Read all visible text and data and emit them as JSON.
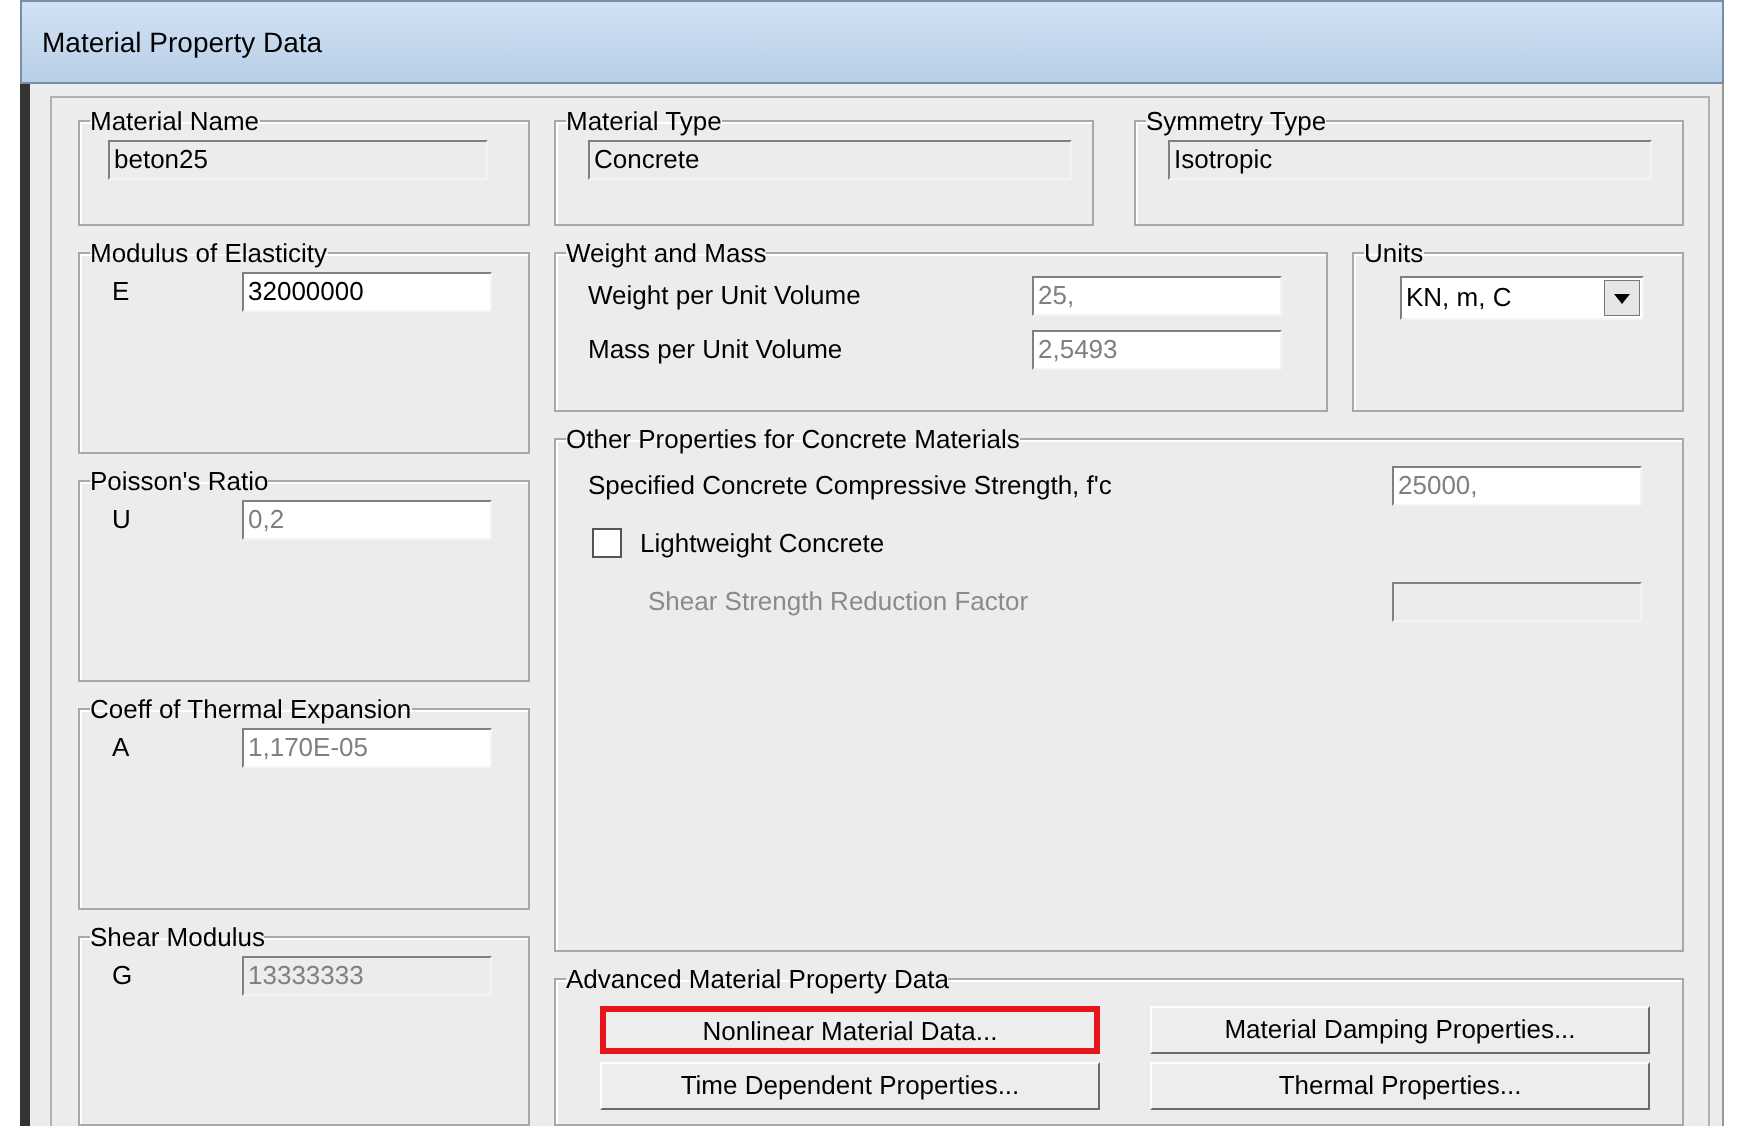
{
  "window": {
    "title": "Material Property Data"
  },
  "material_name": {
    "title": "Material Name",
    "field": {
      "value": "beton25",
      "readonly": true,
      "disabled": false
    }
  },
  "material_type": {
    "title": "Material Type",
    "field": {
      "value": "Concrete",
      "readonly": true,
      "disabled": false
    }
  },
  "symmetry_type": {
    "title": "Symmetry Type",
    "field": {
      "value": "Isotropic",
      "readonly": true,
      "disabled": false
    }
  },
  "left_groups": [
    {
      "title": "Modulus of Elasticity",
      "symbol": "E",
      "field": {
        "value": "32000000",
        "readonly": false,
        "disabled": false
      }
    },
    {
      "title": "Poisson's Ratio",
      "symbol": "U",
      "field": {
        "value": "0,2",
        "readonly": false,
        "disabled": true
      }
    },
    {
      "title": "Coeff of Thermal Expansion",
      "symbol": "A",
      "field": {
        "value": "1,170E-05",
        "readonly": false,
        "disabled": true
      }
    },
    {
      "title": "Shear Modulus",
      "symbol": "G",
      "field": {
        "value": "13333333",
        "readonly": true,
        "disabled": true
      }
    }
  ],
  "weight_and_mass": {
    "title": "Weight and Mass",
    "rows": [
      {
        "label": "Weight per Unit Volume",
        "field": {
          "value": "25,",
          "readonly": false,
          "disabled": true
        }
      },
      {
        "label": "Mass per Unit Volume",
        "field": {
          "value": "2,5493",
          "readonly": false,
          "disabled": true
        }
      }
    ]
  },
  "units": {
    "title": "Units",
    "value": "KN, m, C"
  },
  "other_properties": {
    "title": "Other Properties for Concrete Materials",
    "rows": [
      {
        "kind": "field",
        "label": "Specified Concrete Compressive Strength, f'c",
        "disabled": false,
        "field": {
          "value": "25000,",
          "readonly": false,
          "disabled": true
        }
      },
      {
        "kind": "checkbox",
        "label": "Lightweight Concrete",
        "checked": false
      },
      {
        "kind": "field",
        "label": "Shear Strength Reduction Factor",
        "disabled": true,
        "field": {
          "readonly": true,
          "disabled": true
        }
      }
    ]
  },
  "advanced": {
    "title": "Advanced Material Property Data",
    "buttons": [
      {
        "label": "Nonlinear Material Data...",
        "highlighted": true
      },
      {
        "label": "Material Damping Properties...",
        "highlighted": false
      },
      {
        "label": "Time Dependent Properties...",
        "highlighted": false
      },
      {
        "label": "Thermal Properties...",
        "highlighted": false
      }
    ]
  }
}
